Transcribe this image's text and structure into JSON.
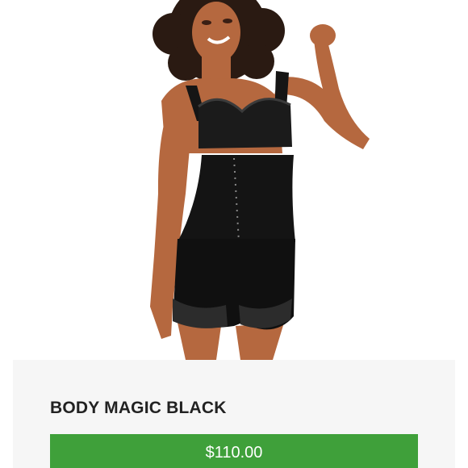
{
  "product": {
    "image_icon": "product-photo",
    "title": "BODY MAGIC BLACK",
    "price": "$110.00"
  },
  "colors": {
    "accent": "#3fa03a",
    "card_background": "#f6f6f6",
    "title_text": "#222222",
    "garment": "#151515",
    "skin": "#b5683f",
    "hair": "#2a1a12"
  }
}
